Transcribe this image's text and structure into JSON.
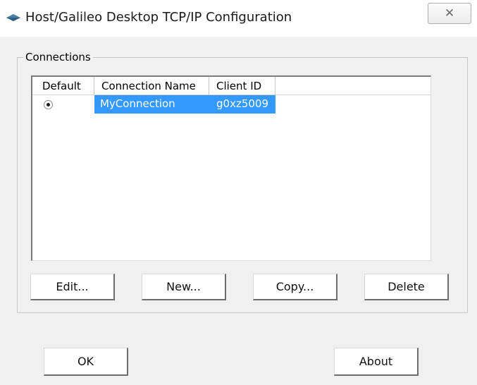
{
  "window": {
    "title": "Host/Galileo Desktop TCP/IP Configuration",
    "icon": "galileo-app-icon",
    "close_icon": "close-icon",
    "close_glyph": "✕"
  },
  "connections_group": {
    "label": "Connections",
    "columns": [
      "Default",
      "Connection Name",
      "Client ID"
    ],
    "rows": [
      {
        "default": true,
        "connection_name": "MyConnection",
        "client_id": "g0xz5009"
      }
    ],
    "selection_color": "#3399ff"
  },
  "buttons": {
    "edit": "Edit...",
    "new": "New...",
    "copy": "Copy...",
    "delete": "Delete",
    "ok": "OK",
    "about": "About"
  }
}
